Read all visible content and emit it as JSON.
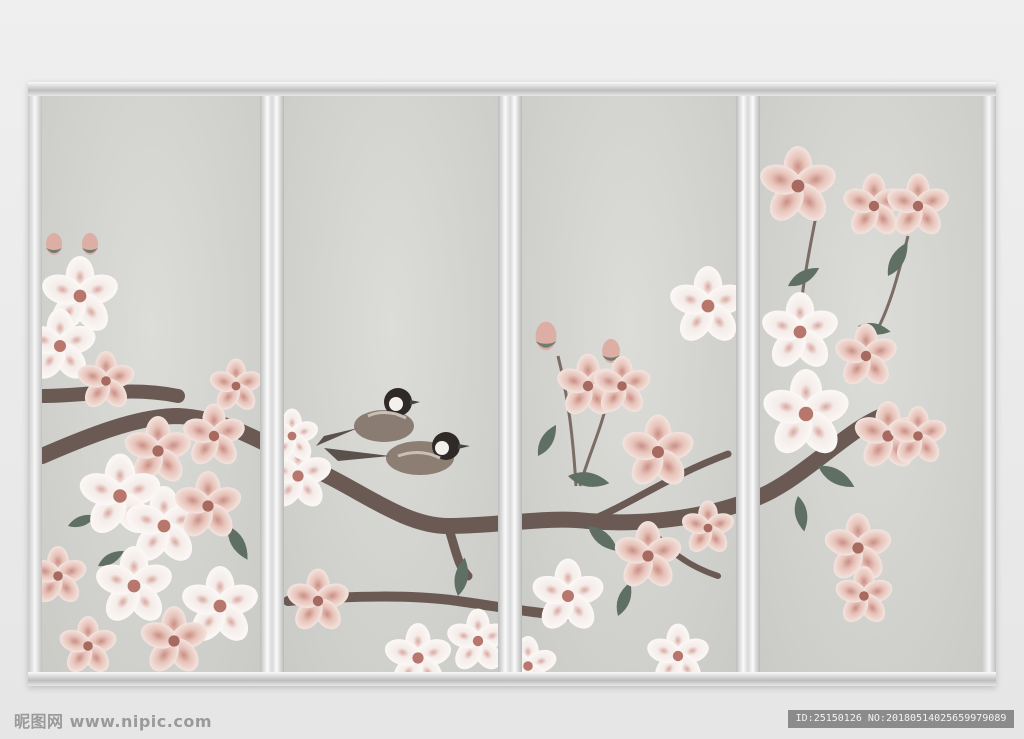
{
  "watermark": {
    "site": "昵图网 www.nipic.com",
    "id_text": "ID:25150126 NO:20180514025659979089"
  },
  "colors": {
    "wall": "#ececec",
    "frame": "#d9d9d9",
    "panel_paper": "#d3d3cf",
    "branch": "#6b5a54",
    "blossom_pink": "#e4b6ab",
    "blossom_white": "#f6f1ee",
    "leaf": "#5f6f63"
  }
}
